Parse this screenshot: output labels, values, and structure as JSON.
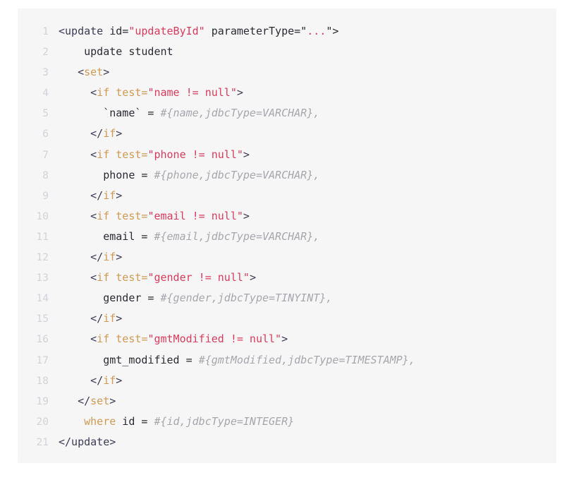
{
  "code_block": {
    "language": "xml",
    "background_color": "#f6f6f6",
    "gutter_color": "#d3d3d8",
    "colors": {
      "plain": "#2a2a33",
      "punct": "#3b3b55",
      "tag": "#d09a54",
      "attribute": "#d09a54",
      "string": "#d93b5c",
      "keyword": "#d09a54",
      "parameter": "#a6a6ad"
    },
    "lines": [
      {
        "number": "1",
        "text": "<update id=\"updateById\" parameterType=\"...\">",
        "tokens": [
          {
            "t": "<update ",
            "c": "punct"
          },
          {
            "t": "id=",
            "c": "plain"
          },
          {
            "t": "\"updateById\"",
            "c": "string"
          },
          {
            "t": " parameterType=\"",
            "c": "plain"
          },
          {
            "t": "...",
            "c": "string"
          },
          {
            "t": "\">",
            "c": "plain"
          }
        ]
      },
      {
        "number": "2",
        "text": "    update student",
        "tokens": [
          {
            "t": "    update student",
            "c": "plain"
          }
        ]
      },
      {
        "number": "3",
        "text": "   <set>",
        "tokens": [
          {
            "t": "   <",
            "c": "punct"
          },
          {
            "t": "set",
            "c": "tag"
          },
          {
            "t": ">",
            "c": "punct"
          }
        ]
      },
      {
        "number": "4",
        "text": "     <if test=\"name != null\">",
        "tokens": [
          {
            "t": "     <",
            "c": "punct"
          },
          {
            "t": "if",
            "c": "tag"
          },
          {
            "t": " test=",
            "c": "attr"
          },
          {
            "t": "\"name != null\"",
            "c": "string"
          },
          {
            "t": ">",
            "c": "punct"
          }
        ]
      },
      {
        "number": "5",
        "text": "       `name` = #{name,jdbcType=VARCHAR},",
        "tokens": [
          {
            "t": "       `name` = ",
            "c": "plain"
          },
          {
            "t": "#{name,jdbcType=VARCHAR},",
            "c": "param"
          }
        ]
      },
      {
        "number": "6",
        "text": "     </if>",
        "tokens": [
          {
            "t": "     </",
            "c": "punct"
          },
          {
            "t": "if",
            "c": "tag"
          },
          {
            "t": ">",
            "c": "punct"
          }
        ]
      },
      {
        "number": "7",
        "text": "     <if test=\"phone != null\">",
        "tokens": [
          {
            "t": "     <",
            "c": "punct"
          },
          {
            "t": "if",
            "c": "tag"
          },
          {
            "t": " test=",
            "c": "attr"
          },
          {
            "t": "\"phone != null\"",
            "c": "string"
          },
          {
            "t": ">",
            "c": "punct"
          }
        ]
      },
      {
        "number": "8",
        "text": "       phone = #{phone,jdbcType=VARCHAR},",
        "tokens": [
          {
            "t": "       phone = ",
            "c": "plain"
          },
          {
            "t": "#{phone,jdbcType=VARCHAR},",
            "c": "param"
          }
        ]
      },
      {
        "number": "9",
        "text": "     </if>",
        "tokens": [
          {
            "t": "     </",
            "c": "punct"
          },
          {
            "t": "if",
            "c": "tag"
          },
          {
            "t": ">",
            "c": "punct"
          }
        ]
      },
      {
        "number": "10",
        "text": "     <if test=\"email != null\">",
        "tokens": [
          {
            "t": "     <",
            "c": "punct"
          },
          {
            "t": "if",
            "c": "tag"
          },
          {
            "t": " test=",
            "c": "attr"
          },
          {
            "t": "\"email != null\"",
            "c": "string"
          },
          {
            "t": ">",
            "c": "punct"
          }
        ]
      },
      {
        "number": "11",
        "text": "       email = #{email,jdbcType=VARCHAR},",
        "tokens": [
          {
            "t": "       email = ",
            "c": "plain"
          },
          {
            "t": "#{email,jdbcType=VARCHAR},",
            "c": "param"
          }
        ]
      },
      {
        "number": "12",
        "text": "     </if>",
        "tokens": [
          {
            "t": "     </",
            "c": "punct"
          },
          {
            "t": "if",
            "c": "tag"
          },
          {
            "t": ">",
            "c": "punct"
          }
        ]
      },
      {
        "number": "13",
        "text": "     <if test=\"gender != null\">",
        "tokens": [
          {
            "t": "     <",
            "c": "punct"
          },
          {
            "t": "if",
            "c": "tag"
          },
          {
            "t": " test=",
            "c": "attr"
          },
          {
            "t": "\"gender != null\"",
            "c": "string"
          },
          {
            "t": ">",
            "c": "punct"
          }
        ]
      },
      {
        "number": "14",
        "text": "       gender = #{gender,jdbcType=TINYINT},",
        "tokens": [
          {
            "t": "       gender = ",
            "c": "plain"
          },
          {
            "t": "#{gender,jdbcType=TINYINT},",
            "c": "param"
          }
        ]
      },
      {
        "number": "15",
        "text": "     </if>",
        "tokens": [
          {
            "t": "     </",
            "c": "punct"
          },
          {
            "t": "if",
            "c": "tag"
          },
          {
            "t": ">",
            "c": "punct"
          }
        ]
      },
      {
        "number": "16",
        "text": "     <if test=\"gmtModified != null\">",
        "tokens": [
          {
            "t": "     <",
            "c": "punct"
          },
          {
            "t": "if",
            "c": "tag"
          },
          {
            "t": " test=",
            "c": "attr"
          },
          {
            "t": "\"gmtModified != null\"",
            "c": "string"
          },
          {
            "t": ">",
            "c": "punct"
          }
        ]
      },
      {
        "number": "17",
        "text": "       gmt_modified = #{gmtModified,jdbcType=TIMESTAMP},",
        "tokens": [
          {
            "t": "       gmt_modified = ",
            "c": "plain"
          },
          {
            "t": "#{gmtModified,jdbcType=TIMESTAMP},",
            "c": "param"
          }
        ]
      },
      {
        "number": "18",
        "text": "     </if>",
        "tokens": [
          {
            "t": "     </",
            "c": "punct"
          },
          {
            "t": "if",
            "c": "tag"
          },
          {
            "t": ">",
            "c": "punct"
          }
        ]
      },
      {
        "number": "19",
        "text": "   </set>",
        "tokens": [
          {
            "t": "   </",
            "c": "punct"
          },
          {
            "t": "set",
            "c": "tag"
          },
          {
            "t": ">",
            "c": "punct"
          }
        ]
      },
      {
        "number": "20",
        "text": "    where id = #{id,jdbcType=INTEGER}",
        "tokens": [
          {
            "t": "    ",
            "c": "plain"
          },
          {
            "t": "where",
            "c": "keyword"
          },
          {
            "t": " id = ",
            "c": "plain"
          },
          {
            "t": "#{id,jdbcType=INTEGER}",
            "c": "param"
          }
        ]
      },
      {
        "number": "21",
        "text": "</update>",
        "tokens": [
          {
            "t": "</update>",
            "c": "punct"
          }
        ]
      }
    ]
  }
}
